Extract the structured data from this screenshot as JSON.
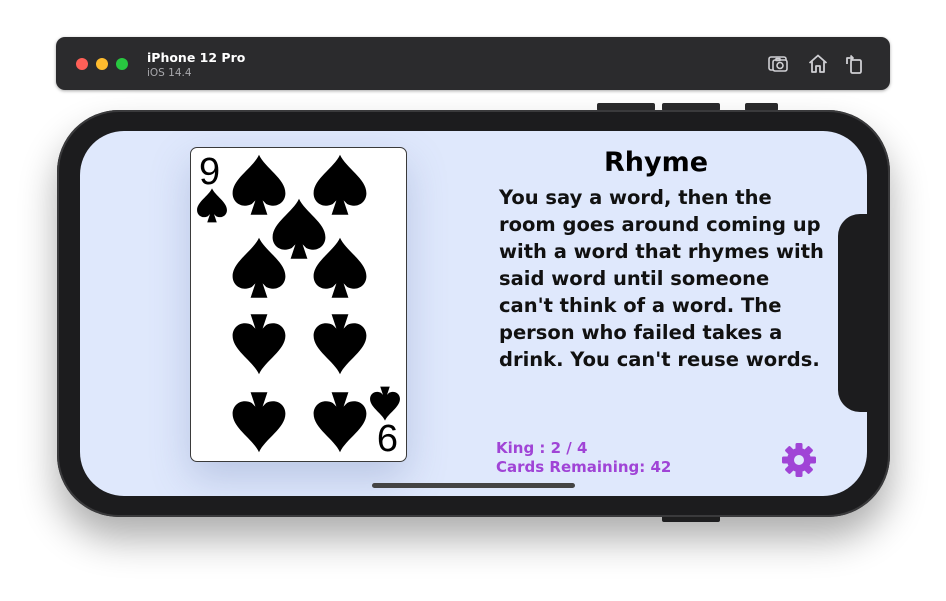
{
  "simulator": {
    "device_name": "iPhone 12 Pro",
    "os_version": "iOS 14.4",
    "toolbar_icons": [
      "screenshot-icon",
      "home-icon",
      "rotate-icon"
    ]
  },
  "card": {
    "rank": "9",
    "suit": "spades",
    "bottom_rank": "6"
  },
  "rule": {
    "title": "Rhyme",
    "description": "You say a word, then the room goes around coming up with a word that rhymes with said word until someone can't think of a word. The person who failed takes a drink. You can't reuse words."
  },
  "status": {
    "king_count": "King : 2 / 4",
    "cards_remaining": "Cards Remaining: 42"
  },
  "colors": {
    "accent": "#a044d6",
    "screen_background": "#dfe8fc"
  },
  "icons": {
    "settings": "gear-icon"
  }
}
